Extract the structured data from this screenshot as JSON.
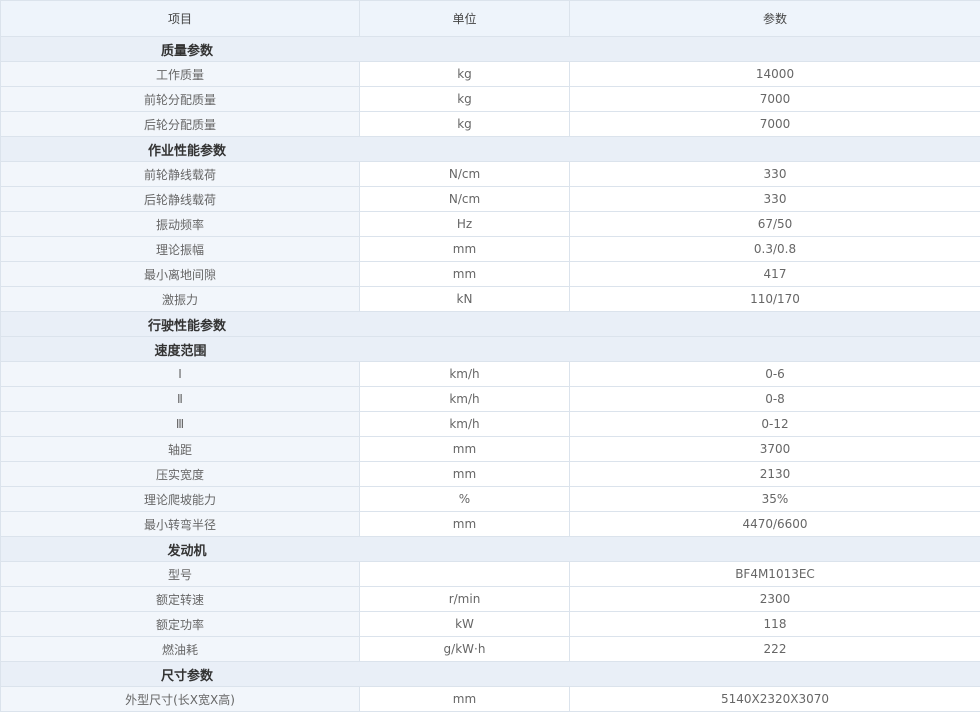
{
  "header": {
    "item": "项目",
    "unit": "单位",
    "value": "参数"
  },
  "rows": [
    {
      "kind": "section",
      "label": "质量参数"
    },
    {
      "kind": "data",
      "label": "工作质量",
      "unit": "kg",
      "value": "14000"
    },
    {
      "kind": "data",
      "label": "前轮分配质量",
      "unit": "kg",
      "value": "7000"
    },
    {
      "kind": "data",
      "label": "后轮分配质量",
      "unit": "kg",
      "value": "7000"
    },
    {
      "kind": "section",
      "label": "作业性能参数"
    },
    {
      "kind": "data",
      "label": "前轮静线载荷",
      "unit": "N/cm",
      "value": "330"
    },
    {
      "kind": "data",
      "label": "后轮静线载荷",
      "unit": "N/cm",
      "value": "330"
    },
    {
      "kind": "data",
      "label": "振动频率",
      "unit": "Hz",
      "value": "67/50"
    },
    {
      "kind": "data",
      "label": "理论振幅",
      "unit": "mm",
      "value": "0.3/0.8"
    },
    {
      "kind": "data",
      "label": "最小离地间隙",
      "unit": "mm",
      "value": "417"
    },
    {
      "kind": "data",
      "label": "激振力",
      "unit": "kN",
      "value": "110/170"
    },
    {
      "kind": "section",
      "label": "行驶性能参数"
    },
    {
      "kind": "subsection",
      "label": "速度范围"
    },
    {
      "kind": "data",
      "label": "Ⅰ",
      "unit": "km/h",
      "value": "0-6"
    },
    {
      "kind": "data",
      "label": "Ⅱ",
      "unit": "km/h",
      "value": "0-8"
    },
    {
      "kind": "data",
      "label": "Ⅲ",
      "unit": "km/h",
      "value": "0-12"
    },
    {
      "kind": "data",
      "label": "轴距",
      "unit": "mm",
      "value": "3700"
    },
    {
      "kind": "data",
      "label": "压实宽度",
      "unit": "mm",
      "value": "2130"
    },
    {
      "kind": "data",
      "label": "理论爬坡能力",
      "unit": "%",
      "value": "35%"
    },
    {
      "kind": "data",
      "label": "最小转弯半径",
      "unit": "mm",
      "value": "4470/6600"
    },
    {
      "kind": "section",
      "label": "发动机"
    },
    {
      "kind": "data",
      "label": "型号",
      "unit": "",
      "value": "BF4M1013EC"
    },
    {
      "kind": "data",
      "label": "额定转速",
      "unit": "r/min",
      "value": "2300"
    },
    {
      "kind": "data",
      "label": "额定功率",
      "unit": "kW",
      "value": "118"
    },
    {
      "kind": "data",
      "label": "燃油耗",
      "unit": "g/kW·h",
      "value": "222"
    },
    {
      "kind": "section",
      "label": "尺寸参数"
    },
    {
      "kind": "data",
      "label": "外型尺寸(长X宽X高)",
      "unit": "mm",
      "value": "5140X2320X3070"
    }
  ]
}
